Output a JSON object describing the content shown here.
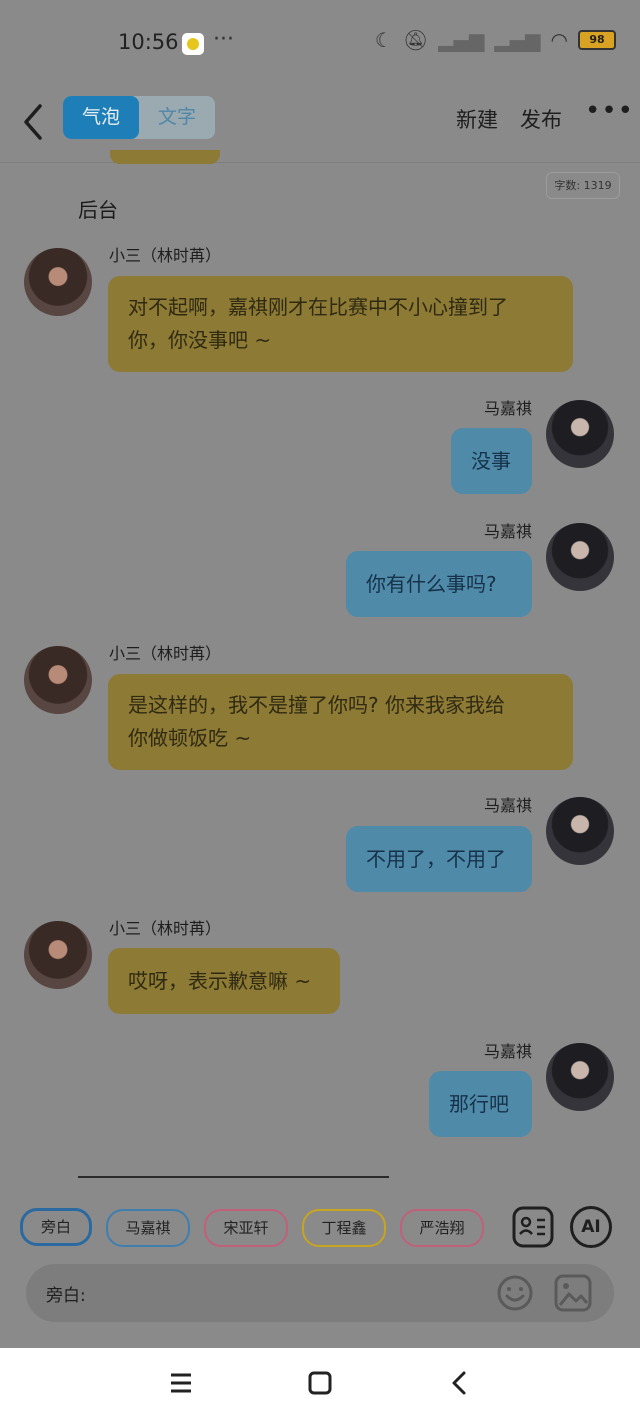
{
  "status": {
    "time": "10:56",
    "more": "···",
    "battery": "98"
  },
  "topbar": {
    "tabs": [
      {
        "label": "气泡",
        "active": true
      },
      {
        "label": "文字",
        "active": false
      }
    ],
    "new_label": "新建",
    "publish_label": "发布",
    "more_label": "•••"
  },
  "word_count": "字数: 1319",
  "scene_label": "后台",
  "messages": [
    {
      "side": "left",
      "name": "小三（林时苒）",
      "text_lines": [
        "对不起啊，嘉祺刚才在比赛中不小心撞到了",
        "你，你没事吧 ~"
      ]
    },
    {
      "side": "right",
      "name": "马嘉祺",
      "text_lines": [
        "没事"
      ]
    },
    {
      "side": "right",
      "name": "马嘉祺",
      "text_lines": [
        "你有什么事吗?"
      ]
    },
    {
      "side": "left",
      "name": "小三（林时苒）",
      "text_lines": [
        "是这样的，我不是撞了你吗? 你来我家我给",
        "你做顿饭吃 ~"
      ]
    },
    {
      "side": "right",
      "name": "马嘉祺",
      "text_lines": [
        "不用了，不用了"
      ]
    },
    {
      "side": "left",
      "name": "小三（林时苒）",
      "text_lines": [
        "哎呀，表示歉意嘛 ~"
      ]
    },
    {
      "side": "right",
      "name": "马嘉祺",
      "text_lines": [
        "那行吧"
      ]
    }
  ],
  "roles": [
    {
      "label": "旁白",
      "color": "#2b6aa0",
      "active": true
    },
    {
      "label": "马嘉祺",
      "color": "#3f7fae"
    },
    {
      "label": "宋亚轩",
      "color": "#c0607a"
    },
    {
      "label": "丁程鑫",
      "color": "#c9a41f"
    },
    {
      "label": "严浩翔",
      "color": "#c0607a"
    }
  ],
  "ai_label": "AI",
  "input": {
    "label": "旁白:"
  },
  "colors": {
    "left_bubble": "#8c7a35",
    "right_bubble": "#4f8aa8",
    "accent": "#1e7fb8"
  },
  "icons": [
    "back-icon",
    "do-not-disturb-moon-icon",
    "mute-bell-icon",
    "signal-icon",
    "wifi-icon",
    "battery-icon",
    "character-card-icon",
    "emoji-icon",
    "image-icon",
    "menu-icon",
    "home-square-icon",
    "nav-back-icon"
  ]
}
